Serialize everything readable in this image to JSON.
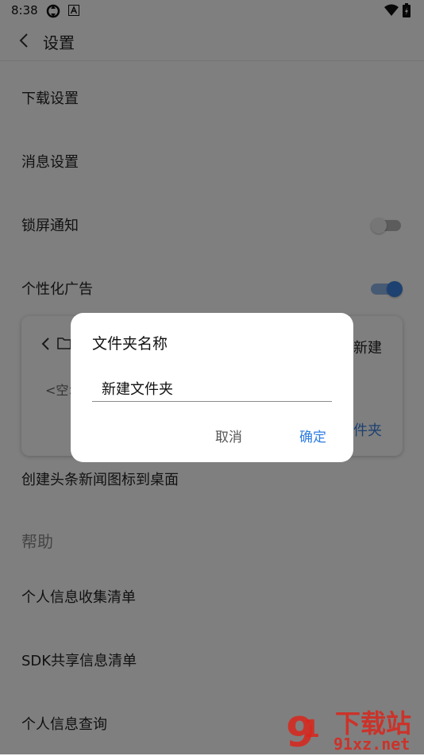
{
  "status_bar": {
    "time": "8:38",
    "icons": [
      "sync-icon",
      "a-notification-icon",
      "wifi-icon",
      "battery-icon"
    ]
  },
  "header": {
    "title": "设置"
  },
  "settings": {
    "download": "下载设置",
    "message": "消息设置",
    "lockscreen": {
      "label": "锁屏通知",
      "enabled": false
    },
    "personalized_ads": {
      "label": "个性化广告",
      "enabled": true
    },
    "create_shortcut": "创建头条新闻图标到桌面",
    "help_section": "帮助",
    "personal_info_list": "个人信息收集清单",
    "sdk_list": "SDK共享信息清单",
    "personal_info_query": "个人信息查询"
  },
  "folder_card": {
    "empty_text": "<空>",
    "new_label": "新建",
    "new_folder_label": "件夹"
  },
  "dialog": {
    "title": "文件夹名称",
    "input_value": "新建文件夹",
    "cancel_label": "取消",
    "ok_label": "确定"
  },
  "watermark": {
    "brand": "下载站",
    "site": "91xz.net"
  },
  "colors": {
    "accent": "#2f7de1",
    "overlay": "rgba(0,0,0,0.5)",
    "watermark_red": "#d9261c"
  }
}
